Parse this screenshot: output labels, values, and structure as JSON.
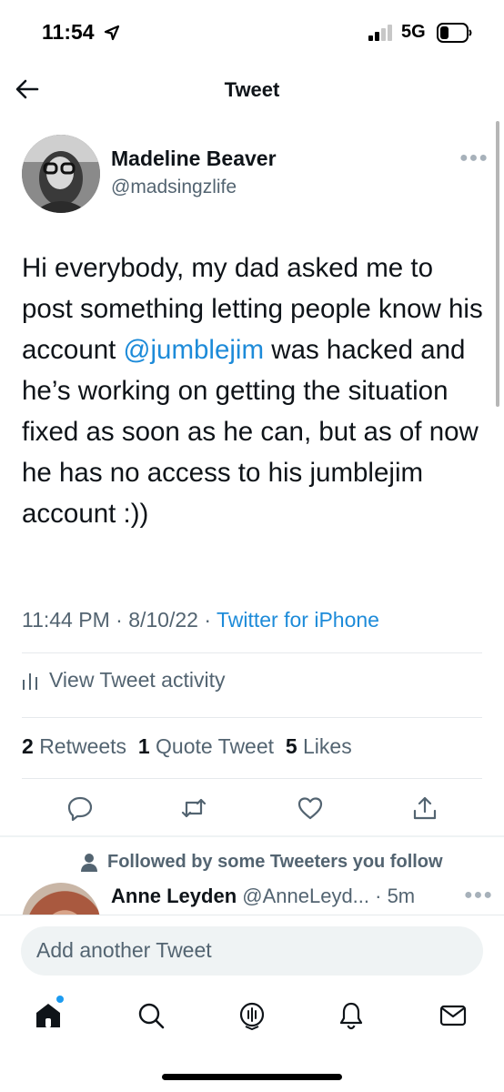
{
  "status_bar": {
    "time": "11:54",
    "network": "5G",
    "location_icon": "location-arrow-icon",
    "signal_icon": "signal-bars-icon",
    "battery_icon": "battery-icon"
  },
  "header": {
    "title": "Tweet",
    "back_icon": "back-arrow-icon"
  },
  "tweet": {
    "author_name": "Madeline Beaver",
    "author_handle": "@madsingzlife",
    "text_before": "Hi everybody, my dad asked me to post something letting people know his account ",
    "mention": "@jumblejim",
    "text_after": " was hacked and he’s working on getting the situation fixed as soon as he can, but as of now he has no access to his jumblejim account :))",
    "time": "11:44 PM",
    "sep1": " · ",
    "date": "8/10/22",
    "sep2": " · ",
    "source": "Twitter for iPhone",
    "activity_label": "View Tweet activity",
    "retweets_count": "2",
    "retweets_label": "Retweets",
    "quotes_count": "1",
    "quotes_label": "Quote Tweet",
    "likes_count": "5",
    "likes_label": "Likes",
    "actions": [
      "reply-icon",
      "retweet-icon",
      "like-icon",
      "share-icon"
    ]
  },
  "reply": {
    "context": "Followed by some Tweeters you follow",
    "name": "Anne Leyden",
    "meta": "@AnneLeyd... · 5m"
  },
  "compose": {
    "placeholder": "Add another Tweet"
  },
  "tab_bar": [
    "home-icon",
    "search-icon",
    "spaces-icon",
    "notifications-icon",
    "messages-icon"
  ],
  "colors": {
    "accent": "#1d9bf0",
    "link": "#1d8bd9",
    "secondary_text": "#536471"
  }
}
